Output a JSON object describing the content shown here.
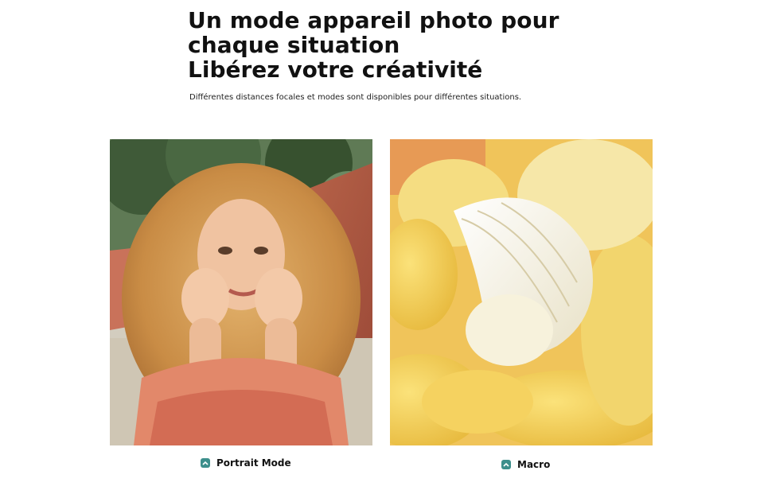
{
  "header": {
    "title": "Un mode appareil photo pour chaque situation",
    "subtitle": "Libérez votre créativité",
    "description": "Différentes distances focales et modes sont disponibles pour différentes situations."
  },
  "gallery": {
    "items": [
      {
        "caption": "Portrait Mode",
        "icon": "chevron-up-icon"
      },
      {
        "caption": "Macro",
        "icon": "chevron-up-icon"
      }
    ]
  },
  "colors": {
    "accent": "#3d8f8c",
    "background": "#ffffff",
    "text": "#111111"
  }
}
